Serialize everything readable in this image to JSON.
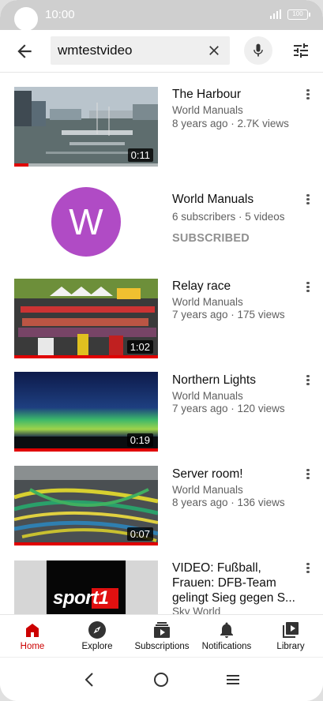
{
  "status_bar": {
    "time": "10:00",
    "battery": "100"
  },
  "search": {
    "query": "wmtestvideo"
  },
  "results": [
    {
      "type": "video",
      "title": "The Harbour",
      "channel": "World Manuals",
      "meta": "8 years ago · 2.7K views",
      "duration": "0:11",
      "watched_fraction": 0.1
    },
    {
      "type": "channel",
      "title": "World Manuals",
      "avatar_letter": "W",
      "meta": "6 subscribers · 5 videos",
      "status": "SUBSCRIBED",
      "avatar_color": "#b04bc5"
    },
    {
      "type": "video",
      "title": "Relay race",
      "channel": "World Manuals",
      "meta": "7 years ago · 175 views",
      "duration": "1:02",
      "watched_fraction": 1.0
    },
    {
      "type": "video",
      "title": "Northern Lights",
      "channel": "World Manuals",
      "meta": "7 years ago · 120 views",
      "duration": "0:19",
      "watched_fraction": 1.0
    },
    {
      "type": "video",
      "title": "Server room!",
      "channel": "World Manuals",
      "meta": "8 years ago · 136 views",
      "duration": "0:07",
      "watched_fraction": 1.0
    },
    {
      "type": "video",
      "title": "VIDEO: Fußball, Frauen: DFB-Team gelingt Sieg gegen S...",
      "channel": "Sky World",
      "thumb_logo": "sport1"
    }
  ],
  "bottom_nav": [
    {
      "label": "Home",
      "icon": "home-icon",
      "active": true
    },
    {
      "label": "Explore",
      "icon": "compass-icon",
      "active": false
    },
    {
      "label": "Subscriptions",
      "icon": "subscriptions-icon",
      "active": false
    },
    {
      "label": "Notifications",
      "icon": "bell-icon",
      "active": false
    },
    {
      "label": "Library",
      "icon": "library-icon",
      "active": false
    }
  ],
  "colors": {
    "accent": "#cc0000",
    "progress": "#e00000",
    "secondary_text": "#606060"
  }
}
